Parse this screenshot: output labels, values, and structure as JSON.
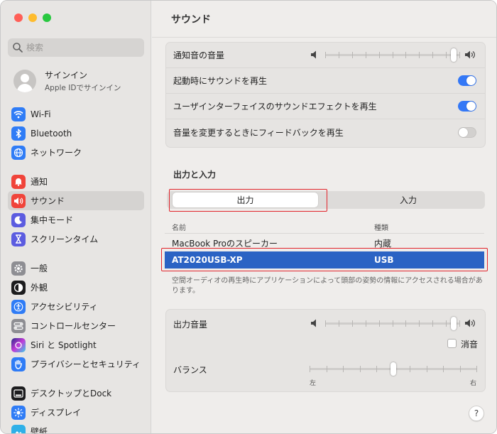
{
  "window": {
    "traffic_colors": [
      "#ff5f57",
      "#febc2e",
      "#28c840"
    ]
  },
  "sidebar": {
    "search_placeholder": "検索",
    "account": {
      "title": "サインイン",
      "subtitle": "Apple IDでサインイン"
    },
    "groups": [
      [
        {
          "label": "Wi-Fi",
          "icon": "wifi-icon",
          "color": "#2f7cf6"
        },
        {
          "label": "Bluetooth",
          "icon": "bluetooth-icon",
          "color": "#2f7cf6"
        },
        {
          "label": "ネットワーク",
          "icon": "globe-icon",
          "color": "#2f7cf6"
        }
      ],
      [
        {
          "label": "通知",
          "icon": "bell-icon",
          "color": "#f0443a"
        },
        {
          "label": "サウンド",
          "icon": "speaker-icon",
          "color": "#f0443a",
          "active": true
        },
        {
          "label": "集中モード",
          "icon": "moon-icon",
          "color": "#5c5ce0"
        },
        {
          "label": "スクリーンタイム",
          "icon": "hourglass-icon",
          "color": "#5c5ce0"
        }
      ],
      [
        {
          "label": "一般",
          "icon": "gear-icon",
          "color": "#8e8e93"
        },
        {
          "label": "外観",
          "icon": "appearance-icon",
          "color": "#1c1c1e"
        },
        {
          "label": "アクセシビリティ",
          "icon": "accessibility-icon",
          "color": "#2f7cf6"
        },
        {
          "label": "コントロールセンター",
          "icon": "control-center-icon",
          "color": "#8e8e93"
        },
        {
          "label": "Siri と Spotlight",
          "icon": "siri-icon",
          "color": "#9a3ad8"
        },
        {
          "label": "プライバシーとセキュリティ",
          "icon": "hand-icon",
          "color": "#2f7cf6"
        }
      ],
      [
        {
          "label": "デスクトップとDock",
          "icon": "dock-icon",
          "color": "#1c1c1e"
        },
        {
          "label": "ディスプレイ",
          "icon": "sun-icon",
          "color": "#2f7cf6"
        },
        {
          "label": "壁紙",
          "icon": "wallpaper-icon",
          "color": "#2fb0e8"
        }
      ]
    ]
  },
  "main": {
    "title": "サウンド",
    "top_settings": {
      "alert_volume": {
        "label": "通知音の音量",
        "value_pct": 95
      },
      "startup_sound": {
        "label": "起動時にサウンドを再生",
        "on": true
      },
      "ui_sound_effects": {
        "label": "ユーザインターフェイスのサウンドエフェクトを再生",
        "on": true
      },
      "volume_feedback": {
        "label": "音量を変更するときにフィードバックを再生",
        "on": false
      }
    },
    "section_title": "出力と入力",
    "tabs": {
      "output": "出力",
      "input": "入力",
      "selected": "output"
    },
    "table": {
      "headers": {
        "name": "名前",
        "type": "種類"
      },
      "rows": [
        {
          "name": "MacBook Proのスピーカー",
          "type": "内蔵",
          "selected": false
        },
        {
          "name": "AT2020USB-XP",
          "type": "USB",
          "selected": true
        }
      ]
    },
    "spatial_note": "空間オーディオの再生時にアプリケーションによって頭部の姿勢の情報にアクセスされる場合があります。",
    "output_volume": {
      "label": "出力音量",
      "value_pct": 95,
      "mute_label": "消音",
      "muted": false
    },
    "balance": {
      "label": "バランス",
      "left": "左",
      "right": "右",
      "value_pct": 50
    },
    "help_label": "?"
  },
  "colors": {
    "accent": "#3478f6",
    "selection": "#2b63c4",
    "highlight_box": "#e2232a"
  }
}
